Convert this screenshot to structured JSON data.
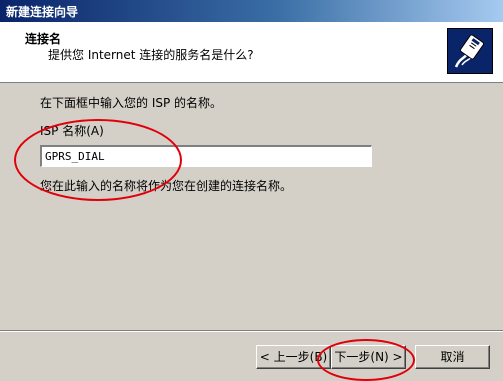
{
  "window": {
    "title": "新建连接向导"
  },
  "header": {
    "title": "连接名",
    "subtitle": "提供您 Internet 连接的服务名是什么?",
    "icon": "network-cable-icon"
  },
  "body": {
    "intro": "在下面框中输入您的 ISP 的名称。",
    "field_label": "ISP 名称(A)",
    "field_value": "GPRS_DIAL",
    "note": "您在此输入的名称将作为您在创建的连接名称。"
  },
  "buttons": {
    "back": "< 上一步(B)",
    "next": "下一步(N) >",
    "cancel": "取消"
  },
  "colors": {
    "title_bar": "#0a246a",
    "dialog_face": "#d4d0c8",
    "annotation": "#e0000a"
  }
}
